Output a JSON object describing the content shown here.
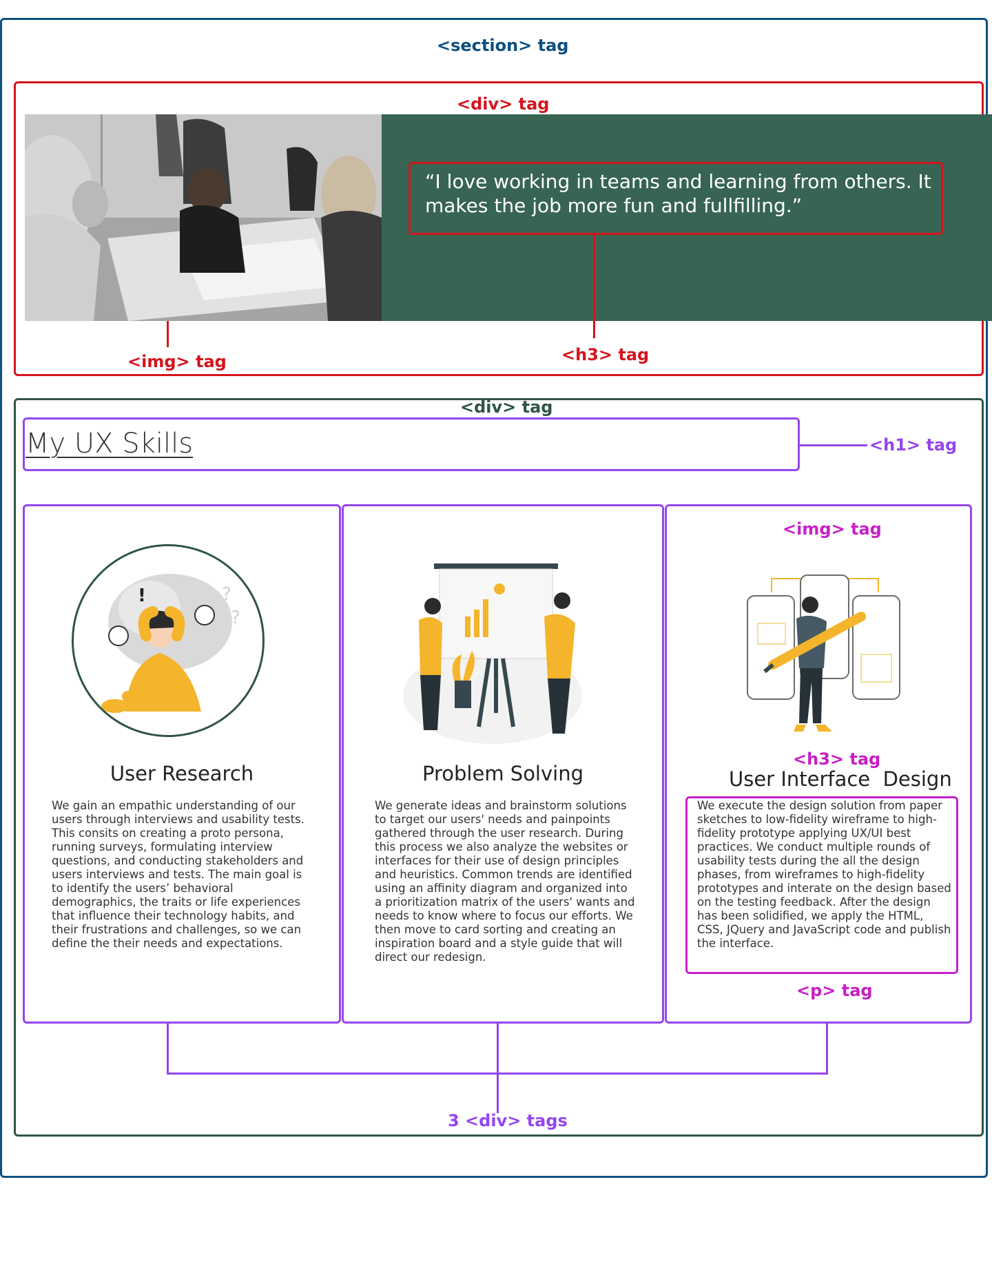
{
  "labels": {
    "section": "<section> tag",
    "div_top": "<div> tag",
    "img_top": "<img> tag",
    "h3_top": "<h3> tag",
    "div_bottom": "<div> tag",
    "h1": "<h1> tag",
    "img_card": "<img> tag",
    "h3_card": "<h3> tag",
    "p": "<p> tag",
    "divs": "3 <div> tags"
  },
  "quote": "“I love working in teams and learning from others. It makes the job more fun and fullfilling.”",
  "heading": "My UX Skills",
  "cards": [
    {
      "title": "User Research",
      "text": "We gain an empathic understanding of our users through interviews and usability tests. This consits on creating a proto persona, running surveys, formulating interview questions, and conducting stakeholders and users interviews and tests. The main goal is to identify the users’ behavioral demographics, the traits or life experiences that influence their technology habits, and their frustrations and challenges, so we can define the their needs and expectations."
    },
    {
      "title": "Problem Solving",
      "text": "We generate ideas and brainstorm solutions to target our users' needs and painpoints gathered through the user research. During this process we also analyze the websites or interfaces for their use of design principles and heuristics. Common trends are identified using an affinity diagram and organized into a prioritization matrix of the users' wants and needs to know where to focus our efforts. We then move to card sorting and creating an inspiration board and a style guide that will direct our redesign."
    },
    {
      "title": "User Interface  Design",
      "text": "We execute the design solution from paper sketches to low-fidelity wireframe to high-fidelity prototype applying UX/UI best practices. We conduct multiple rounds of usability tests during the all the design phases, from wireframes to high-fidelity prototypes and interate on the design based on the testing feedback. After the design has been solidified, we apply the HTML, CSS, JQuery and JavaScript code and publish the interface."
    }
  ],
  "colors": {
    "section": "#0d4f82",
    "div_top": "#d4141c",
    "div_bottom": "#2f5447",
    "structure": "#9446ee",
    "element": "#c81fc8",
    "quote_bg": "#386453",
    "accent": "#f4b42b"
  }
}
